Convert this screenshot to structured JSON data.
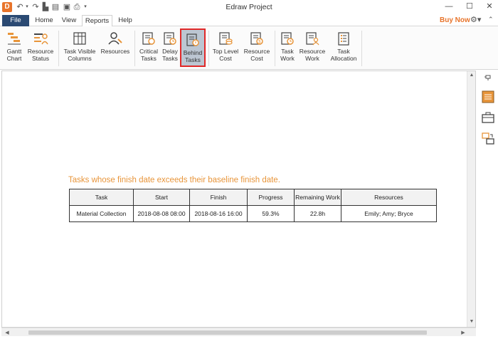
{
  "window": {
    "title": "Edraw Project"
  },
  "header": {
    "buy_now": "Buy Now"
  },
  "tabs": [
    {
      "label": "File"
    },
    {
      "label": "Home"
    },
    {
      "label": "View"
    },
    {
      "label": "Reports"
    },
    {
      "label": "Help"
    }
  ],
  "ribbon": {
    "buttons": [
      {
        "label": "Gantt Chart",
        "icon": "gantt-chart-icon"
      },
      {
        "label": "Resource Status",
        "icon": "resource-status-icon"
      },
      {
        "label": "Task Visible Columns",
        "icon": "task-visible-columns-icon"
      },
      {
        "label": "Resources",
        "icon": "resources-icon"
      },
      {
        "label": "Critical Tasks",
        "icon": "critical-tasks-icon"
      },
      {
        "label": "Delay Tasks",
        "icon": "delay-tasks-icon"
      },
      {
        "label": "Behind Tasks",
        "icon": "behind-tasks-icon",
        "selected": true
      },
      {
        "label": "Top Level Cost",
        "icon": "top-level-cost-icon"
      },
      {
        "label": "Resource Cost",
        "icon": "resource-cost-icon"
      },
      {
        "label": "Task Work",
        "icon": "task-work-icon"
      },
      {
        "label": "Resource Work",
        "icon": "resource-work-icon"
      },
      {
        "label": "Task Allocation",
        "icon": "task-allocation-icon"
      }
    ]
  },
  "report": {
    "heading": "Tasks whose finish date exceeds their baseline finish date.",
    "columns": [
      "Task",
      "Start",
      "Finish",
      "Progress",
      "Remaining Work",
      "Resources"
    ],
    "rows": [
      [
        "Material Collection",
        "2018-08-08 08:00",
        "2018-08-16 16:00",
        "59.3%",
        "22.8h",
        "Emily; Amy; Bryce"
      ]
    ]
  },
  "colors": {
    "accent": "#e8742b",
    "file_tab": "#2b4a73",
    "selected_border": "#e02828"
  }
}
